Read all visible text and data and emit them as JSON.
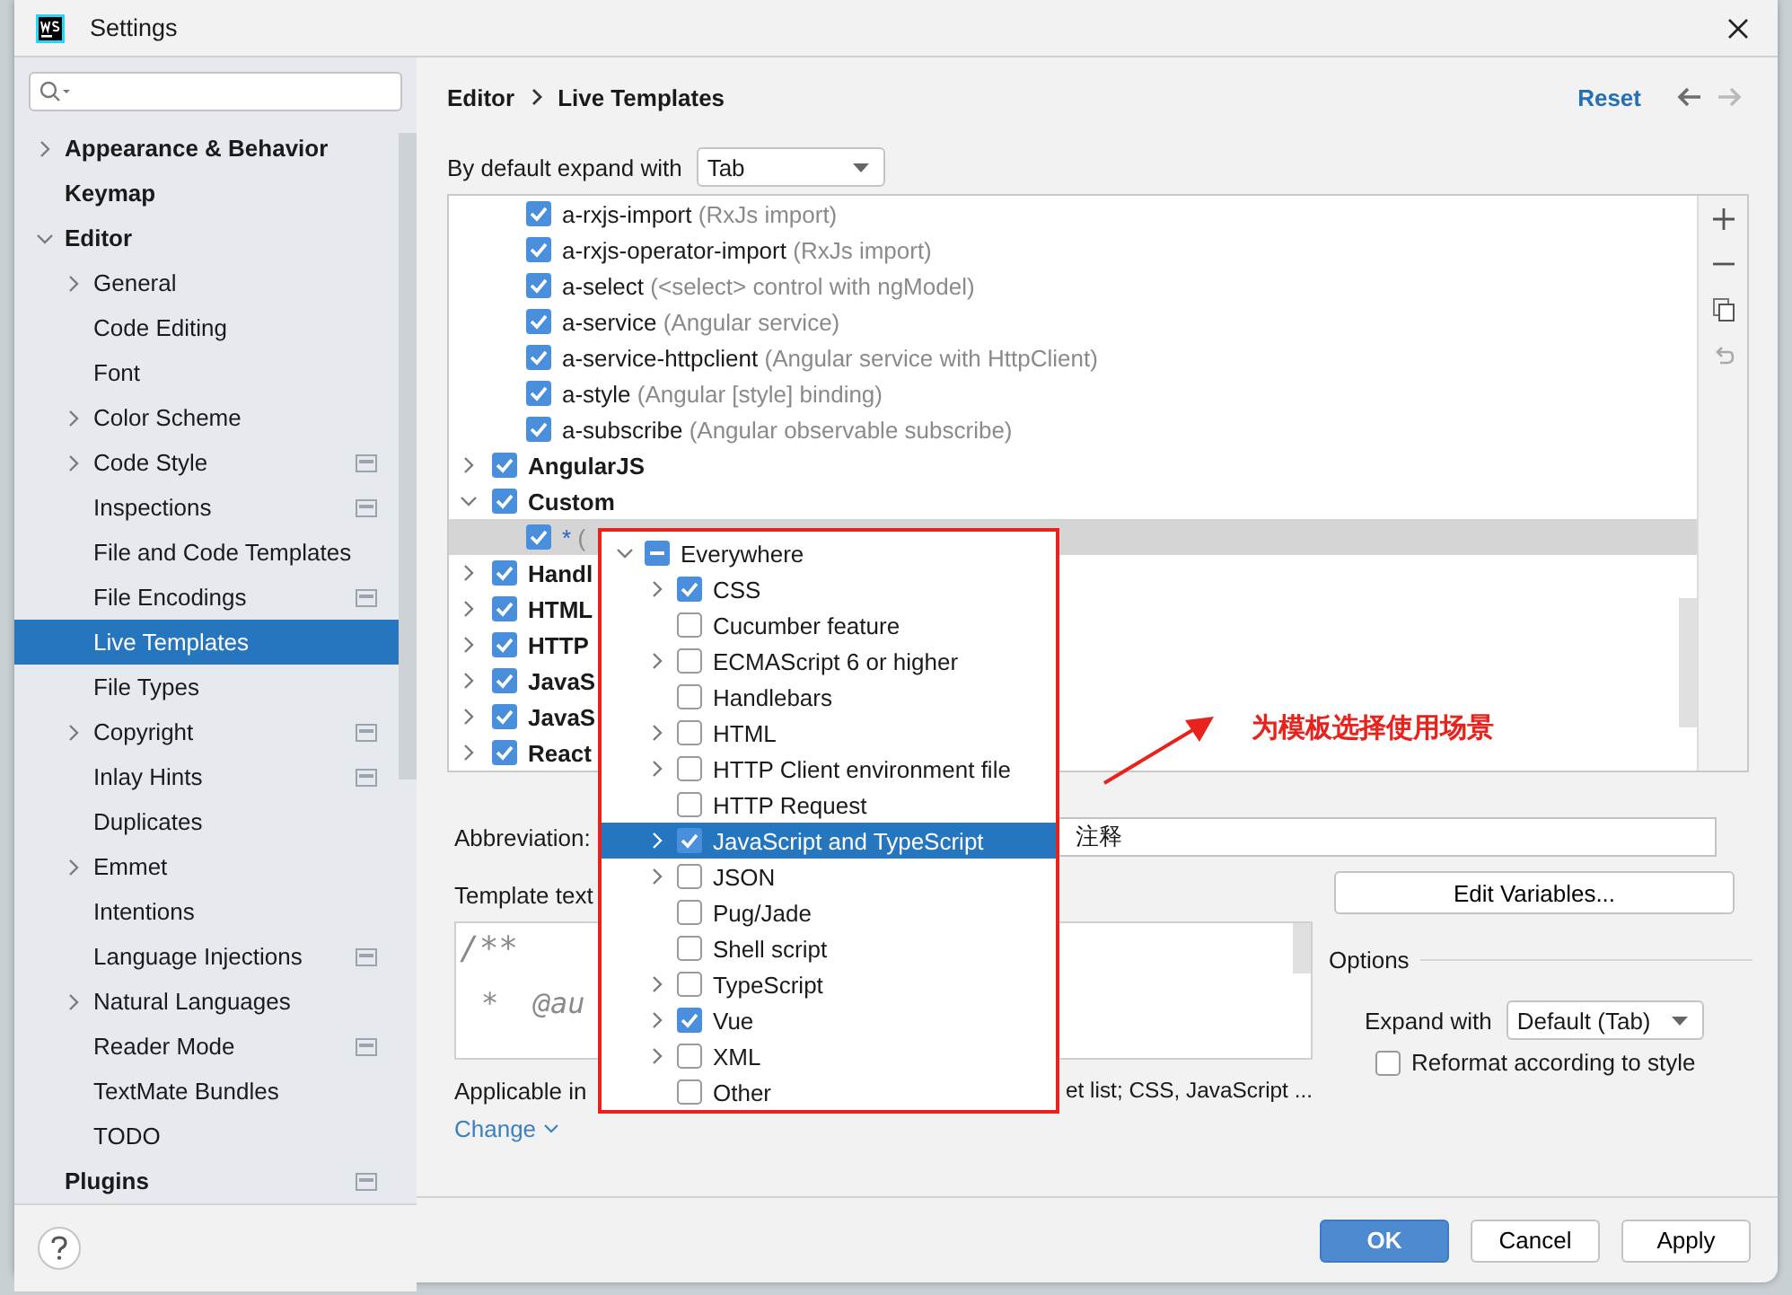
{
  "window": {
    "title": "Settings"
  },
  "sidebar": {
    "items": [
      {
        "label": "Appearance & Behavior",
        "bold": true,
        "expanded": false,
        "selected": false,
        "project_icon": false
      },
      {
        "label": "Keymap",
        "bold": true,
        "selected": false,
        "project_icon": false
      },
      {
        "label": "Editor",
        "bold": true,
        "expanded": true,
        "selected": false,
        "project_icon": false,
        "children": [
          {
            "label": "General",
            "expanded": false,
            "selected": false,
            "project_icon": false
          },
          {
            "label": "Code Editing",
            "selected": false,
            "project_icon": false
          },
          {
            "label": "Font",
            "selected": false,
            "project_icon": false
          },
          {
            "label": "Color Scheme",
            "expanded": false,
            "selected": false,
            "project_icon": false
          },
          {
            "label": "Code Style",
            "expanded": false,
            "selected": false,
            "project_icon": true
          },
          {
            "label": "Inspections",
            "selected": false,
            "project_icon": true
          },
          {
            "label": "File and Code Templates",
            "selected": false,
            "project_icon": false
          },
          {
            "label": "File Encodings",
            "selected": false,
            "project_icon": true
          },
          {
            "label": "Live Templates",
            "selected": true,
            "project_icon": false
          },
          {
            "label": "File Types",
            "selected": false,
            "project_icon": false
          },
          {
            "label": "Copyright",
            "expanded": false,
            "selected": false,
            "project_icon": true
          },
          {
            "label": "Inlay Hints",
            "selected": false,
            "project_icon": true
          },
          {
            "label": "Duplicates",
            "selected": false,
            "project_icon": false
          },
          {
            "label": "Emmet",
            "expanded": false,
            "selected": false,
            "project_icon": false
          },
          {
            "label": "Intentions",
            "selected": false,
            "project_icon": false
          },
          {
            "label": "Language Injections",
            "selected": false,
            "project_icon": true
          },
          {
            "label": "Natural Languages",
            "expanded": false,
            "selected": false,
            "project_icon": false
          },
          {
            "label": "Reader Mode",
            "selected": false,
            "project_icon": true
          },
          {
            "label": "TextMate Bundles",
            "selected": false,
            "project_icon": false
          },
          {
            "label": "TODO",
            "selected": false,
            "project_icon": false
          }
        ]
      },
      {
        "label": "Plugins",
        "bold": true,
        "selected": false,
        "project_icon": true
      }
    ]
  },
  "breadcrumb": [
    "Editor",
    "Live Templates"
  ],
  "reset_link": "Reset",
  "nav": {
    "back_disabled": false,
    "forward_disabled": true
  },
  "expand_default": {
    "label": "By default expand with",
    "value": "Tab"
  },
  "templates": [
    {
      "kind": "template",
      "name": "a-rxjs-import",
      "description": "(RxJs import)",
      "checked": true,
      "selected": false
    },
    {
      "kind": "template",
      "name": "a-rxjs-operator-import",
      "description": "(RxJs import)",
      "checked": true,
      "selected": false
    },
    {
      "kind": "template",
      "name": "a-select",
      "description": "(<select> control with ngModel)",
      "checked": true,
      "selected": false
    },
    {
      "kind": "template",
      "name": "a-service",
      "description": "(Angular service)",
      "checked": true,
      "selected": false
    },
    {
      "kind": "template",
      "name": "a-service-httpclient",
      "description": "(Angular service with HttpClient)",
      "checked": true,
      "selected": false
    },
    {
      "kind": "template",
      "name": "a-style",
      "description": "(Angular [style] binding)",
      "checked": true,
      "selected": false
    },
    {
      "kind": "template",
      "name": "a-subscribe",
      "description": "(Angular observable subscribe)",
      "checked": true,
      "selected": false
    },
    {
      "kind": "group",
      "name": "AngularJS",
      "checked": true,
      "expanded": false,
      "selected": false
    },
    {
      "kind": "group",
      "name": "Custom",
      "checked": true,
      "expanded": true,
      "selected": false,
      "children": [
        {
          "kind": "template",
          "name": "*",
          "description": "(",
          "checked": true,
          "selected": true,
          "modified": true
        }
      ]
    },
    {
      "kind": "group",
      "name": "Handl",
      "checked": true,
      "expanded": false,
      "selected": false
    },
    {
      "kind": "group",
      "name": "HTML",
      "checked": true,
      "expanded": false,
      "selected": false
    },
    {
      "kind": "group",
      "name": "HTTP",
      "checked": true,
      "expanded": false,
      "selected": false
    },
    {
      "kind": "group",
      "name": "JavaS",
      "checked": true,
      "expanded": false,
      "selected": false
    },
    {
      "kind": "group",
      "name": "JavaS",
      "checked": true,
      "expanded": false,
      "selected": false
    },
    {
      "kind": "group",
      "name": "React",
      "checked": true,
      "expanded": false,
      "selected": false
    }
  ],
  "context_popup": {
    "items": [
      {
        "label": "Everywhere",
        "indeterminate": true,
        "expanded": true,
        "selected": false,
        "children": [
          {
            "label": "CSS",
            "checked": true,
            "expanded": false,
            "selected": false
          },
          {
            "label": "Cucumber feature",
            "checked": false,
            "selected": false
          },
          {
            "label": "ECMAScript 6 or higher",
            "checked": false,
            "expanded": false,
            "selected": false
          },
          {
            "label": "Handlebars",
            "checked": false,
            "selected": false
          },
          {
            "label": "HTML",
            "checked": false,
            "expanded": false,
            "selected": false
          },
          {
            "label": "HTTP Client environment file",
            "checked": false,
            "expanded": false,
            "selected": false
          },
          {
            "label": "HTTP Request",
            "checked": false,
            "selected": false
          },
          {
            "label": "JavaScript and TypeScript",
            "checked": true,
            "expanded": false,
            "selected": true
          },
          {
            "label": "JSON",
            "checked": false,
            "expanded": false,
            "selected": false
          },
          {
            "label": "Pug/Jade",
            "checked": false,
            "selected": false
          },
          {
            "label": "Shell script",
            "checked": false,
            "selected": false
          },
          {
            "label": "TypeScript",
            "checked": false,
            "expanded": false,
            "selected": false
          },
          {
            "label": "Vue",
            "checked": true,
            "expanded": false,
            "selected": false
          },
          {
            "label": "XML",
            "checked": false,
            "expanded": false,
            "selected": false
          },
          {
            "label": "Other",
            "checked": false,
            "selected": false
          }
        ]
      }
    ]
  },
  "annotation": {
    "text": "为模板选择使用场景"
  },
  "abbreviation": {
    "label": "Abbreviation:",
    "value": "注释"
  },
  "template_text": {
    "label": "Template text",
    "lines": [
      "/**",
      "*  @au"
    ]
  },
  "applicable": {
    "label": "Applicable in",
    "value": "et list; CSS, JavaScript ..."
  },
  "change_link": "Change",
  "edit_variables_button": "Edit Variables...",
  "options": {
    "title": "Options",
    "expand_label": "Expand with",
    "expand_value": "Default (Tab)",
    "reformat": {
      "label": "Reformat according to style",
      "checked": false
    }
  },
  "buttons": [
    {
      "label": "OK",
      "primary": true
    },
    {
      "label": "Cancel",
      "primary": false
    },
    {
      "label": "Apply",
      "primary": false
    }
  ]
}
